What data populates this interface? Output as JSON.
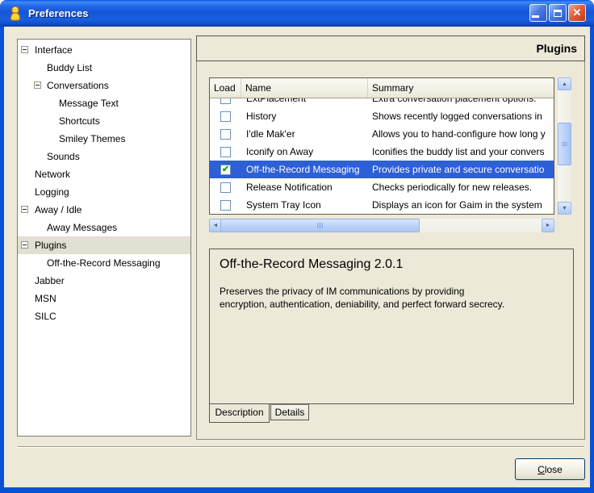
{
  "titlebar": {
    "title": "Preferences"
  },
  "tree": {
    "items": [
      {
        "label": "Interface",
        "level": 0,
        "expander": true,
        "selected": false
      },
      {
        "label": "Buddy List",
        "level": 1,
        "expander": false,
        "selected": false
      },
      {
        "label": "Conversations",
        "level": 1,
        "expander": true,
        "selected": false
      },
      {
        "label": "Message Text",
        "level": 2,
        "expander": false,
        "selected": false
      },
      {
        "label": "Shortcuts",
        "level": 2,
        "expander": false,
        "selected": false
      },
      {
        "label": "Smiley Themes",
        "level": 2,
        "expander": false,
        "selected": false
      },
      {
        "label": "Sounds",
        "level": 1,
        "expander": false,
        "selected": false
      },
      {
        "label": "Network",
        "level": 0,
        "expander": false,
        "selected": false
      },
      {
        "label": "Logging",
        "level": 0,
        "expander": false,
        "selected": false
      },
      {
        "label": "Away / Idle",
        "level": 0,
        "expander": true,
        "selected": false
      },
      {
        "label": "Away Messages",
        "level": 1,
        "expander": false,
        "selected": false
      },
      {
        "label": "Plugins",
        "level": 0,
        "expander": true,
        "selected": true
      },
      {
        "label": "Off-the-Record Messaging",
        "level": 1,
        "expander": false,
        "selected": false
      },
      {
        "label": "Jabber",
        "level": 0,
        "expander": false,
        "selected": false
      },
      {
        "label": "MSN",
        "level": 0,
        "expander": false,
        "selected": false
      },
      {
        "label": "SILC",
        "level": 0,
        "expander": false,
        "selected": false
      }
    ]
  },
  "panel": {
    "title": "Plugins",
    "table": {
      "columns": [
        "Load",
        "Name",
        "Summary"
      ],
      "rows": [
        {
          "checked": false,
          "partial": true,
          "selected": false,
          "name": "ExtPlacement",
          "summary": "Extra conversation placement options."
        },
        {
          "checked": false,
          "partial": false,
          "selected": false,
          "name": "History",
          "summary": "Shows recently logged conversations in"
        },
        {
          "checked": false,
          "partial": false,
          "selected": false,
          "name": "I'dle Mak'er",
          "summary": "Allows you to hand-configure how long y"
        },
        {
          "checked": false,
          "partial": false,
          "selected": false,
          "name": "Iconify on Away",
          "summary": "Iconifies the buddy list and your convers"
        },
        {
          "checked": true,
          "partial": false,
          "selected": true,
          "name": "Off-the-Record Messaging",
          "summary": "Provides private and secure conversatio"
        },
        {
          "checked": false,
          "partial": false,
          "selected": false,
          "name": "Release Notification",
          "summary": "Checks periodically for new releases."
        },
        {
          "checked": false,
          "partial": false,
          "selected": false,
          "name": "System Tray Icon",
          "summary": "Displays an icon for Gaim in the system"
        }
      ]
    },
    "details": {
      "title": "Off-the-Record Messaging 2.0.1",
      "description": "Preserves the privacy of IM communications by providing encryption, authentication, deniability, and perfect forward secrecy.",
      "tabs": [
        {
          "label": "Description",
          "active": true
        },
        {
          "label": "Details",
          "active": false
        }
      ]
    }
  },
  "footer": {
    "close_mnemonic": "C",
    "close_rest": "lose"
  },
  "colors": {
    "dialog_bg": "#ECE9D8",
    "window_border": "#0B51D8",
    "titlebar_blue": "#1557D8",
    "selection_blue": "#2D5FD5",
    "tree_selection": "#E2DFD3",
    "check_green": "#18A318",
    "close_red": "#D6512E",
    "scrollbar_blue": "#BCD2F7"
  }
}
